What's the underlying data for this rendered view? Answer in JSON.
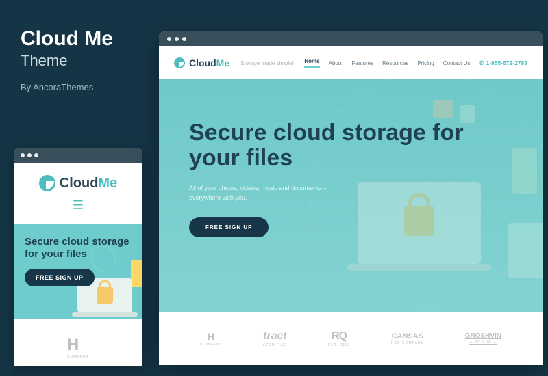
{
  "header": {
    "title": "Cloud Me",
    "subtitle": "Theme",
    "byline": "By AncoraThemes"
  },
  "logo": {
    "part1": "Cloud",
    "part2": "Me"
  },
  "mobile": {
    "hero_title": "Secure cloud storage for your files",
    "cta": "FREE SIGN UP",
    "brand_letter": "H",
    "brand_sub": "COMPANY"
  },
  "desktop": {
    "tagline": "Storage made simple!",
    "nav": {
      "home": "Home",
      "about": "About",
      "features": "Features",
      "resources": "Resources",
      "pricing": "Pricing",
      "contact": "Contact Us"
    },
    "phone": "1-855-672-2788",
    "hero_title": "Secure cloud storage for your files",
    "hero_sub1": "All of your photos, videos, music and documents –",
    "hero_sub2": "everywhere with you.",
    "cta": "FREE SIGN UP",
    "brands": {
      "b1": "H",
      "b1_sub": "COMPANY",
      "b2": "tract",
      "b2_sub": "STOR F.CO",
      "b3": "RQ",
      "b3_sub": "EST. 2010",
      "b4": "CANSAS",
      "b4_sub": "RSO COMPANY",
      "b5": "GROSHVIN",
      "b5_sub": "— BY GVR —"
    }
  }
}
